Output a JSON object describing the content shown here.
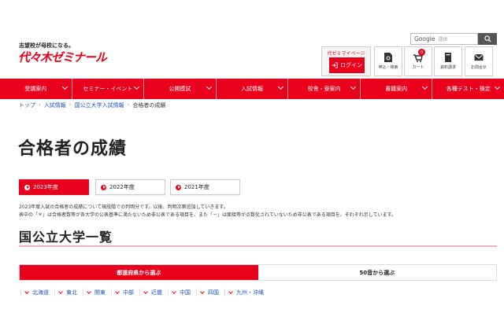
{
  "header": {
    "tagline": "志望校が母校になる。",
    "logo": "代々木ゼミナール",
    "search_brand": "Google",
    "search_placeholder": "提供",
    "mypage_title": "代ゼミマイページ",
    "login_label": "ログイン",
    "utilities": [
      {
        "label": "申込・検索",
        "icon": "document-search-icon"
      },
      {
        "label": "カート",
        "icon": "cart-icon",
        "badge": "0"
      },
      {
        "label": "資料請求",
        "icon": "book-icon"
      },
      {
        "label": "お問合せ",
        "icon": "mail-icon"
      }
    ]
  },
  "nav": {
    "items": [
      "受講案内",
      "セミナー・イベント",
      "公開模試",
      "入試情報",
      "校舎・寮案内",
      "書籍案内",
      "各種テスト・検定"
    ]
  },
  "breadcrumb": {
    "items": [
      "トップ",
      "入試情報",
      "国公立大学入試情報"
    ],
    "current": "合格者の成績"
  },
  "page": {
    "title": "合格者の成績"
  },
  "year_tabs": [
    "2023年度",
    "2022年度",
    "2021年度"
  ],
  "notes": [
    "2023年度入試の合格者の成績について現段階での判明分です。以後、判明次第追加していきます。",
    "表中の「＊」は合格者数等が各大学の公表基準に満たないため非公表である項目を、また「－」は面接等が点数化されていないため非公表である項目を、それぞれ示しています。"
  ],
  "section": {
    "title": "国公立大学一覧"
  },
  "select_tabs": [
    "都道府県から選ぶ",
    "50音から選ぶ"
  ],
  "regions": [
    "北海道",
    "東北",
    "関東",
    "中部",
    "近畿",
    "中国",
    "四国",
    "九州・沖縄"
  ],
  "colors": {
    "brand_red": "#e8001c",
    "link_blue": "#1a56b8",
    "rule_pink": "#f4b3bb"
  }
}
